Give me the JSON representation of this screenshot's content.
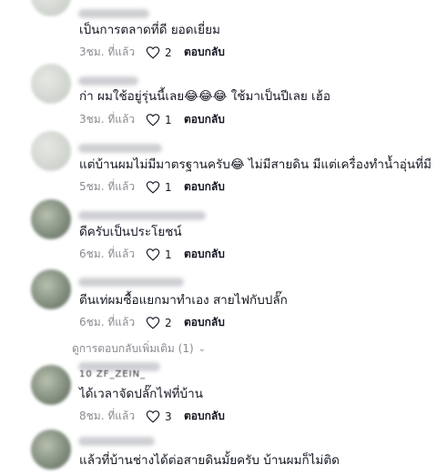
{
  "comments": [
    {
      "text": "เป็นการตลาดที่ดี ยอดเยี่ยม",
      "time": "3ชม. ที่แล้ว",
      "likes": "2",
      "reply": "ตอบกลับ"
    },
    {
      "text": "ก่า ผมใช้อยู่รุ่นนี้เลย😂😂😂 ใช้มาเป็นปีเลย เฮ้อ",
      "time": "3ชม. ที่แล้ว",
      "likes": "1",
      "reply": "ตอบกลับ"
    },
    {
      "text": "แต่บ้านผมไม่มีมาตรฐานครับ😂 ไม่มีสายดิน มีแต่เครื่องทำน้ำอุ่นที่มี",
      "time": "5ชม. ที่แล้ว",
      "likes": "1",
      "reply": "ตอบกลับ"
    },
    {
      "text": "ดีครับเป็นประโยชน์",
      "time": "6ชม. ที่แล้ว",
      "likes": "1",
      "reply": "ตอบกลับ"
    },
    {
      "text": "ตีนเท่ผมซื้อแยกมาทำเอง สายไฟกับปลั๊ก",
      "time": "6ชม. ที่แล้ว",
      "likes": "2",
      "reply": "ตอบกลับ"
    },
    {
      "text": "ได้เวลาจัดปลั๊กไฟที่บ้าน",
      "time": "8ชม. ที่แล้ว",
      "likes": "3",
      "reply": "ตอบกลับ"
    },
    {
      "text": "แล้วที่บ้านช่างได้ต่อสายดินมั้ยครับ บ้านผมก็ไม่ติด",
      "time": "",
      "likes": "",
      "reply": ""
    }
  ],
  "more_replies": "ดูการตอบกลับเพิ่มเติม (1)",
  "partial_handle": "10 ZF_ZEIN_",
  "colors": {
    "text": "#161823",
    "secondary": "#8a8b91",
    "background": "#ffffff"
  }
}
